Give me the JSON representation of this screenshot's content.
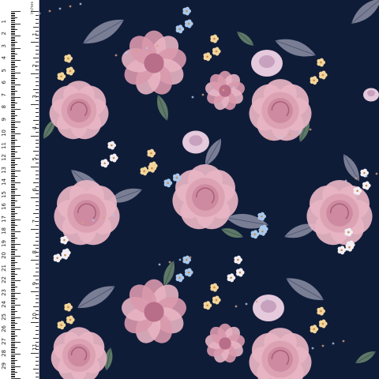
{
  "ruler": {
    "unit_label": "inches",
    "cm_labels": [
      "1",
      "2",
      "3",
      "4",
      "5",
      "6",
      "7",
      "8",
      "9",
      "10",
      "11",
      "12",
      "13",
      "14",
      "15",
      "16",
      "17",
      "18",
      "19",
      "20",
      "21",
      "22",
      "23",
      "24",
      "25",
      "26",
      "27",
      "28",
      "29",
      "30"
    ],
    "inch_labels": [
      "1",
      "2",
      "3",
      "4",
      "5",
      "6",
      "7",
      "8",
      "9",
      "10",
      "11",
      "12"
    ]
  },
  "fabric": {
    "background_color": "#0f1c38",
    "rose_color": "#e8b5c4",
    "rose_dark": "#c9849b",
    "leaf_color": "#6c8a6e",
    "grey_leaf_color": "#8c8fa6",
    "blue_flower_color": "#a8c8ec",
    "yellow_flower_color": "#f2d59a",
    "white_flower_color": "#f2eef4"
  }
}
